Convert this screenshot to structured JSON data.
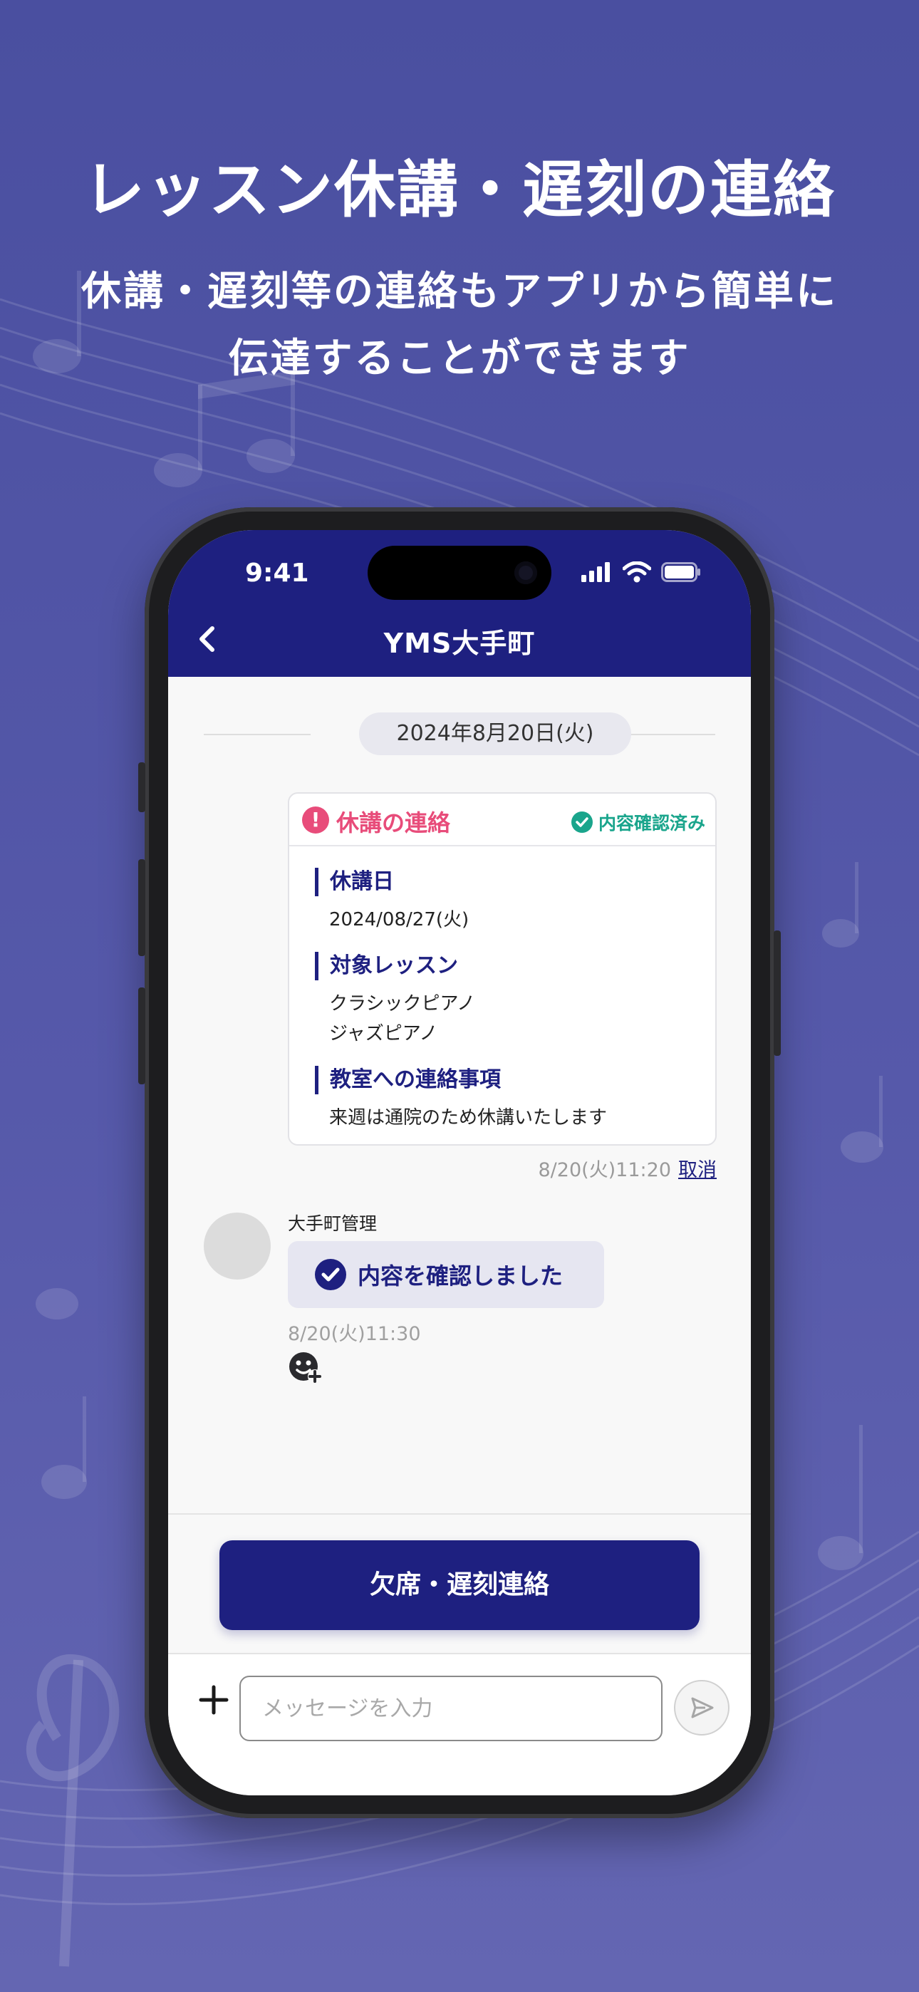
{
  "promo": {
    "headline": "レッスン休講・遅刻の連絡",
    "subline1": "休講・遅刻等の連絡もアプリから簡単に",
    "subline2": "伝達することができます"
  },
  "status_bar": {
    "time": "9:41"
  },
  "header": {
    "title": "YMS大手町"
  },
  "chat": {
    "date": "2024年8月20日(火)",
    "card": {
      "title": "休講の連絡",
      "status": "内容確認済み",
      "sections": [
        {
          "label": "休講日",
          "lines": [
            "2024/08/27(火)"
          ]
        },
        {
          "label": "対象レッスン",
          "lines": [
            "クラシックピアノ",
            "ジャズピアノ"
          ]
        },
        {
          "label": "教室への連絡事項",
          "lines": [
            "来週は通院のため休講いたします"
          ]
        }
      ],
      "timestamp": "8/20(火)11:20",
      "cancel_label": "取消"
    },
    "reply": {
      "sender": "大手町管理",
      "message": "内容を確認しました",
      "timestamp": "8/20(火)11:30"
    }
  },
  "action_button": {
    "label": "欠席・遅刻連絡"
  },
  "composer": {
    "placeholder": "メッセージを入力",
    "value": ""
  },
  "colors": {
    "primary": "#1e2080",
    "alert": "#e84c7a",
    "confirmed": "#1aa58c",
    "background": "#5053a6"
  }
}
